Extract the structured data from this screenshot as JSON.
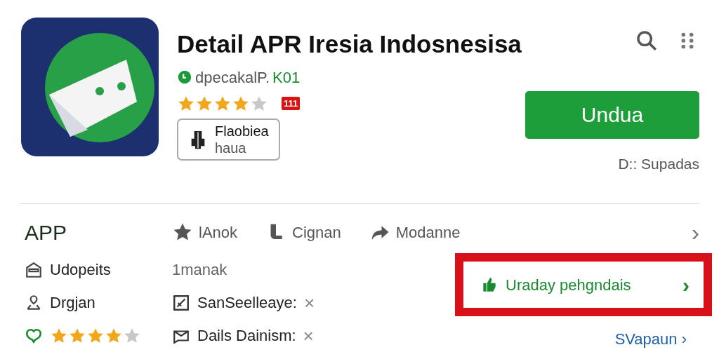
{
  "header": {
    "title": "Detail APR Iresia Indosnesisa",
    "developer": "dpecakalP.",
    "developer_badge": "K01",
    "stars": 4,
    "count_badge": "111",
    "tag_lines": [
      "Flaobiea",
      "haua"
    ],
    "download_button": "Undua",
    "size_note": "D:: Supadas"
  },
  "section": {
    "title": "APP",
    "actions": [
      {
        "label": "lAnok"
      },
      {
        "label": "Cignan"
      },
      {
        "label": "Modanne"
      }
    ],
    "chevron": "›"
  },
  "info_left": [
    {
      "kind": "text",
      "label": "Udopeits"
    },
    {
      "kind": "text",
      "label": "Drgjan"
    },
    {
      "kind": "rating",
      "stars": 4
    }
  ],
  "info_middle": [
    {
      "kind": "text",
      "label": "1manak"
    },
    {
      "kind": "removable",
      "label": "SanSeelleaye:",
      "remove": "×"
    },
    {
      "kind": "removable",
      "label": "Dails Dainism:",
      "remove": "×"
    }
  ],
  "highlight_button": {
    "label": "Uraday pehgndais",
    "chevron": "›"
  },
  "link": {
    "label": "SVapaun",
    "chevron": "›"
  }
}
